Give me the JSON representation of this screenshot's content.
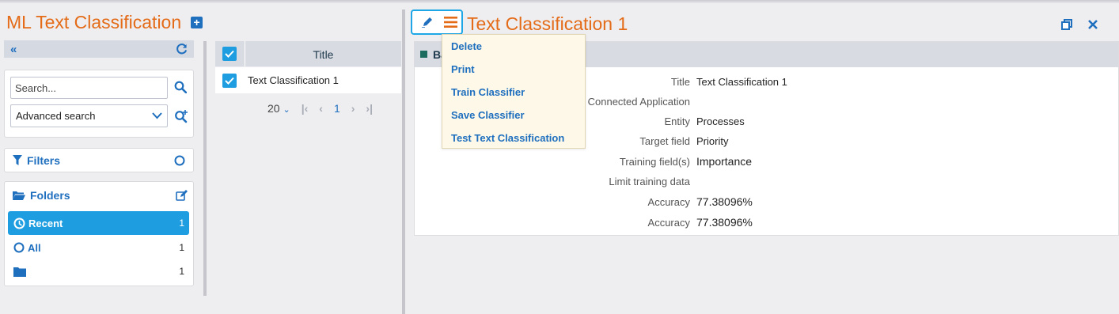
{
  "module": {
    "title": "ML Text Classification"
  },
  "nav": {
    "collapse_icon": "double-chevron-left-icon",
    "refresh_icon": "refresh-icon"
  },
  "search": {
    "placeholder": "Search...",
    "advanced_label": "Advanced search"
  },
  "filters": {
    "label": "Filters"
  },
  "folders": {
    "label": "Folders",
    "items": [
      {
        "label": "Recent",
        "count": "1",
        "icon": "clock-icon",
        "active": true
      },
      {
        "label": "All",
        "count": "1",
        "icon": "circle-icon",
        "active": false
      },
      {
        "label": "",
        "count": "1",
        "icon": "folder-icon",
        "active": false
      }
    ]
  },
  "list": {
    "header": "Title",
    "rows": [
      {
        "title": "Text Classification 1"
      }
    ],
    "pager": {
      "page_size": "20",
      "page": "1"
    }
  },
  "detail": {
    "title": "Text Classification 1",
    "section_label": "Ba",
    "fields": [
      {
        "label": "Title",
        "value": "Text Classification 1"
      },
      {
        "label": "Connected Application",
        "value": ""
      },
      {
        "label": "Entity",
        "value": "Processes"
      },
      {
        "label": "Target field",
        "value": "Priority"
      },
      {
        "label": "Training field(s)",
        "value": "Importance"
      },
      {
        "label": "Limit training data",
        "value": ""
      },
      {
        "label": "Accuracy",
        "value": "77.38096%"
      },
      {
        "label": "Accuracy",
        "value": "77.38096%"
      }
    ]
  },
  "menu": {
    "items": [
      "Delete",
      "Print",
      "Train Classifier",
      "Save Classifier",
      "Test Text Classification"
    ]
  },
  "colors": {
    "accent_orange": "#e46b17",
    "link_blue": "#1f6fbf",
    "active_blue": "#1e9ee0"
  }
}
